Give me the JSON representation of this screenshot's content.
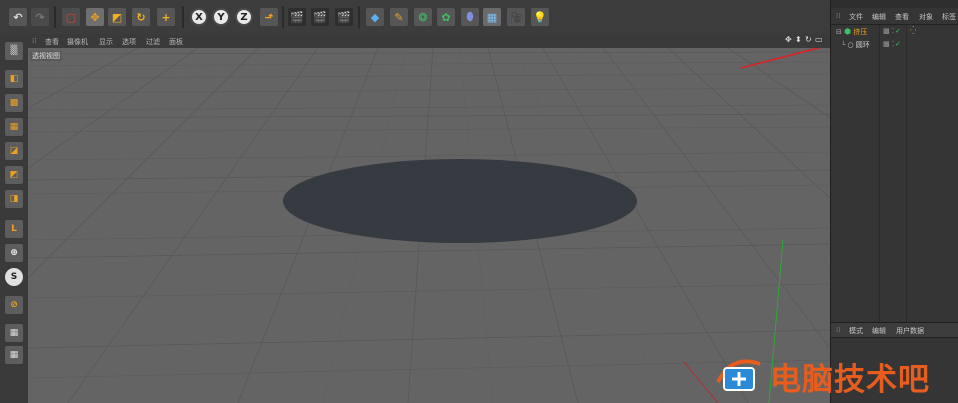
{
  "toolbar": {
    "axis_x": "X",
    "axis_y": "Y",
    "axis_z": "Z"
  },
  "viewport": {
    "menu": [
      "查看",
      "摄像机",
      "显示",
      "选项",
      "过滤",
      "面板"
    ],
    "label": "透视视图"
  },
  "object_manager": {
    "menu": [
      "文件",
      "编辑",
      "查看",
      "对象",
      "标签"
    ],
    "objects": [
      {
        "name": "挤压",
        "icon": "extrude-icon",
        "color": "#39c26a"
      },
      {
        "name": "圆环",
        "icon": "circle-spline-icon",
        "color": "#cfcfcf"
      }
    ]
  },
  "attributes": {
    "menu": [
      "模式",
      "编辑",
      "用户数据"
    ]
  },
  "left_palette_icons": [
    "model-icon",
    "texture-icon",
    "workplane-icon",
    "point-icon",
    "edge-icon",
    "polygon-icon",
    "axis-icon",
    "tweak-icon",
    "snap-icon",
    "enable-icon",
    "lock-grid-icon",
    "lock-icon"
  ],
  "watermark": {
    "text": "电脑技术吧"
  },
  "colors": {
    "accent_orange": "#e65d1e",
    "annotation_red": "#e02020",
    "disc": "#363b42",
    "viewport": "#646464"
  }
}
